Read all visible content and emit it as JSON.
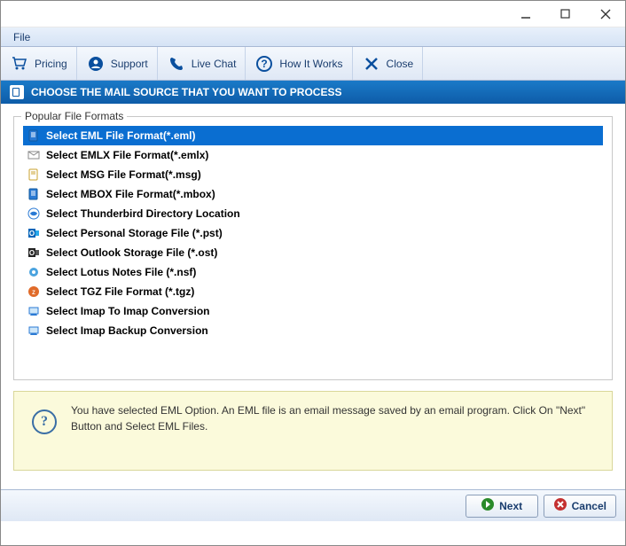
{
  "menu": {
    "file": "File"
  },
  "toolbar": {
    "pricing": "Pricing",
    "support": "Support",
    "livechat": "Live Chat",
    "howitworks": "How It Works",
    "close": "Close"
  },
  "banner": {
    "title": "CHOOSE THE MAIL SOURCE THAT YOU WANT TO PROCESS"
  },
  "group": {
    "title": "Popular File Formats"
  },
  "formats": [
    {
      "label": "Select EML File Format(*.eml)",
      "selected": true,
      "icon": "doc-blue"
    },
    {
      "label": "Select EMLX File Format(*.emlx)",
      "selected": false,
      "icon": "envelope"
    },
    {
      "label": "Select MSG File Format(*.msg)",
      "selected": false,
      "icon": "doc-yellow"
    },
    {
      "label": "Select MBOX File Format(*.mbox)",
      "selected": false,
      "icon": "doc-blue"
    },
    {
      "label": "Select Thunderbird Directory Location",
      "selected": false,
      "icon": "thunderbird"
    },
    {
      "label": "Select Personal Storage File (*.pst)",
      "selected": false,
      "icon": "outlook"
    },
    {
      "label": "Select Outlook Storage File (*.ost)",
      "selected": false,
      "icon": "outlook-dark"
    },
    {
      "label": "Select Lotus Notes File (*.nsf)",
      "selected": false,
      "icon": "lotus"
    },
    {
      "label": "Select TGZ File Format (*.tgz)",
      "selected": false,
      "icon": "tgz"
    },
    {
      "label": "Select Imap To Imap Conversion",
      "selected": false,
      "icon": "imap"
    },
    {
      "label": "Select Imap Backup Conversion",
      "selected": false,
      "icon": "imap"
    }
  ],
  "info": {
    "text": "You have selected EML Option. An EML file is an email message saved by an email program. Click On \"Next\" Button and Select EML Files."
  },
  "footer": {
    "next": "Next",
    "cancel": "Cancel"
  }
}
